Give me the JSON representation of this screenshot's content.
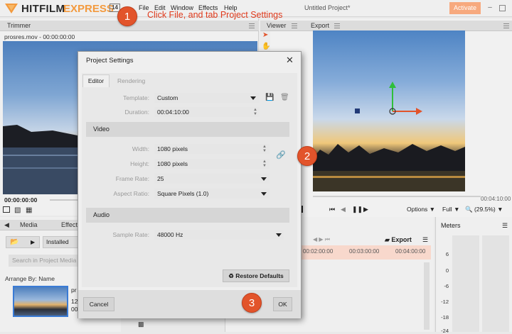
{
  "app": {
    "brand_primary": "HITFILM",
    "brand_secondary": "EXPRESS",
    "version": "14",
    "project_title": "Untitled Project*",
    "activate_label": "Activate",
    "accent_color": "#f39a3e"
  },
  "menu": [
    "File",
    "Edit",
    "Window",
    "Effects",
    "Help"
  ],
  "annotation": {
    "note": "Click File, and tab Project Settings",
    "badges": [
      "1",
      "2",
      "3"
    ]
  },
  "trimmer": {
    "tab": "Trimmer",
    "clip_label": "prosres.mov - 00:00:00:00",
    "timecode": "00:00:00:00"
  },
  "viewer": {
    "tabs": [
      "Viewer",
      "Export"
    ],
    "end_timecode": "00:04:10:00",
    "options_label": "Options",
    "full_label": "Full",
    "zoom_label": "(29.5%)"
  },
  "media": {
    "tabs": [
      "Media",
      "Effects"
    ],
    "installed_label": "Installed",
    "search_placeholder": "Search in Project Media",
    "arrange_label": "Arrange By: Name",
    "thumb_text": [
      "pr",
      "12",
      "00"
    ]
  },
  "timeline": {
    "export_label": "Export",
    "timecodes": [
      "00:02:00:00",
      "00:03:00:00",
      "00:04:00:00"
    ]
  },
  "meters": {
    "title": "Meters",
    "ticks": [
      "6",
      "0",
      "-6",
      "-12",
      "-18",
      "-24"
    ]
  },
  "dialog": {
    "title": "Project Settings",
    "tabs": [
      "Editor",
      "Rendering"
    ],
    "template_label": "Template:",
    "template_value": "Custom",
    "duration_label": "Duration:",
    "duration_value": "00:04:10:00",
    "video_section": "Video",
    "width_label": "Width:",
    "width_value": "1080 pixels",
    "height_label": "Height:",
    "height_value": "1080 pixels",
    "framerate_label": "Frame Rate:",
    "framerate_value": "25",
    "aspect_label": "Aspect Ratio:",
    "aspect_value": "Square Pixels (1.0)",
    "audio_section": "Audio",
    "samplerate_label": "Sample Rate:",
    "samplerate_value": "48000 Hz",
    "restore_label": "Restore Defaults",
    "cancel_label": "Cancel",
    "ok_label": "OK"
  }
}
